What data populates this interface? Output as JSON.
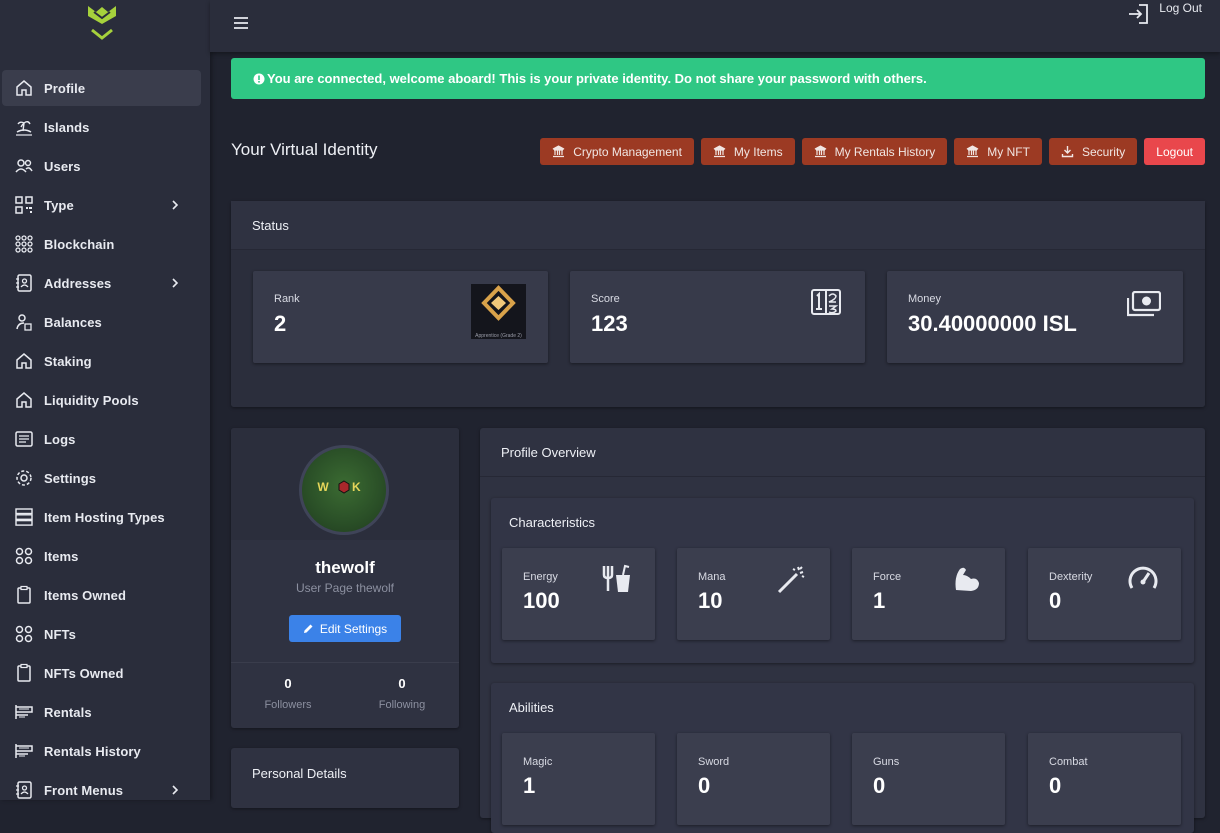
{
  "sidebar": {
    "items": [
      {
        "label": "Profile",
        "icon": "home-icon",
        "active": true
      },
      {
        "label": "Islands",
        "icon": "island-icon"
      },
      {
        "label": "Users",
        "icon": "users-icon"
      },
      {
        "label": "Type",
        "icon": "qr-icon",
        "submenu": true
      },
      {
        "label": "Blockchain",
        "icon": "grid-icon"
      },
      {
        "label": "Addresses",
        "icon": "address-book-icon",
        "submenu": true
      },
      {
        "label": "Balances",
        "icon": "user-balance-icon"
      },
      {
        "label": "Staking",
        "icon": "home-icon"
      },
      {
        "label": "Liquidity Pools",
        "icon": "home-icon"
      },
      {
        "label": "Logs",
        "icon": "logs-icon"
      },
      {
        "label": "Settings",
        "icon": "gear-icon"
      },
      {
        "label": "Item Hosting Types",
        "icon": "server-icon"
      },
      {
        "label": "Items",
        "icon": "circles-icon"
      },
      {
        "label": "Items Owned",
        "icon": "clipboard-icon"
      },
      {
        "label": "NFTs",
        "icon": "circles-icon"
      },
      {
        "label": "NFTs Owned",
        "icon": "clipboard-icon"
      },
      {
        "label": "Rentals",
        "icon": "rentals-icon"
      },
      {
        "label": "Rentals History",
        "icon": "rentals-icon"
      },
      {
        "label": "Front Menus",
        "icon": "address-book-icon",
        "submenu": true
      }
    ]
  },
  "topbar": {
    "logout_label": "Log Out"
  },
  "alert": {
    "text": "You are connected, welcome aboard! This is your private identity. Do not share your password with others."
  },
  "page": {
    "title": "Your Virtual Identity",
    "actions": [
      {
        "label": "Crypto Management",
        "icon": "bank-icon"
      },
      {
        "label": "My Items",
        "icon": "bank-icon"
      },
      {
        "label": "My Rentals History",
        "icon": "bank-icon"
      },
      {
        "label": "My NFT",
        "icon": "bank-icon"
      },
      {
        "label": "Security",
        "icon": "download-icon"
      }
    ],
    "logout_button": "Logout"
  },
  "status": {
    "title": "Status",
    "rank": {
      "label": "Rank",
      "value": "2",
      "badge_caption": "Apprentice (Grade 2)"
    },
    "score": {
      "label": "Score",
      "value": "123"
    },
    "money": {
      "label": "Money",
      "value": "30.40000000 ISL"
    }
  },
  "profile": {
    "username": "thewolf",
    "subtitle": "User Page thewolf",
    "edit_label": "Edit Settings",
    "avatar_text": "W K",
    "followers": {
      "count": "0",
      "label": "Followers"
    },
    "following": {
      "count": "0",
      "label": "Following"
    }
  },
  "personal": {
    "title": "Personal Details"
  },
  "overview": {
    "title": "Profile Overview",
    "characteristics": {
      "title": "Characteristics",
      "items": [
        {
          "label": "Energy",
          "value": "100",
          "icon": "utensils-icon"
        },
        {
          "label": "Mana",
          "value": "10",
          "icon": "magic-wand-icon"
        },
        {
          "label": "Force",
          "value": "1",
          "icon": "bicep-icon"
        },
        {
          "label": "Dexterity",
          "value": "0",
          "icon": "speedometer-icon"
        }
      ]
    },
    "abilities": {
      "title": "Abilities",
      "items": [
        {
          "label": "Magic",
          "value": "1"
        },
        {
          "label": "Sword",
          "value": "0"
        },
        {
          "label": "Guns",
          "value": "0"
        },
        {
          "label": "Combat",
          "value": "0"
        }
      ]
    }
  },
  "colors": {
    "alert": "#2fc784",
    "action": "#9c3a23",
    "logout": "#e9474c",
    "edit": "#3b82e8",
    "accent_logo": "#a6d13c"
  }
}
